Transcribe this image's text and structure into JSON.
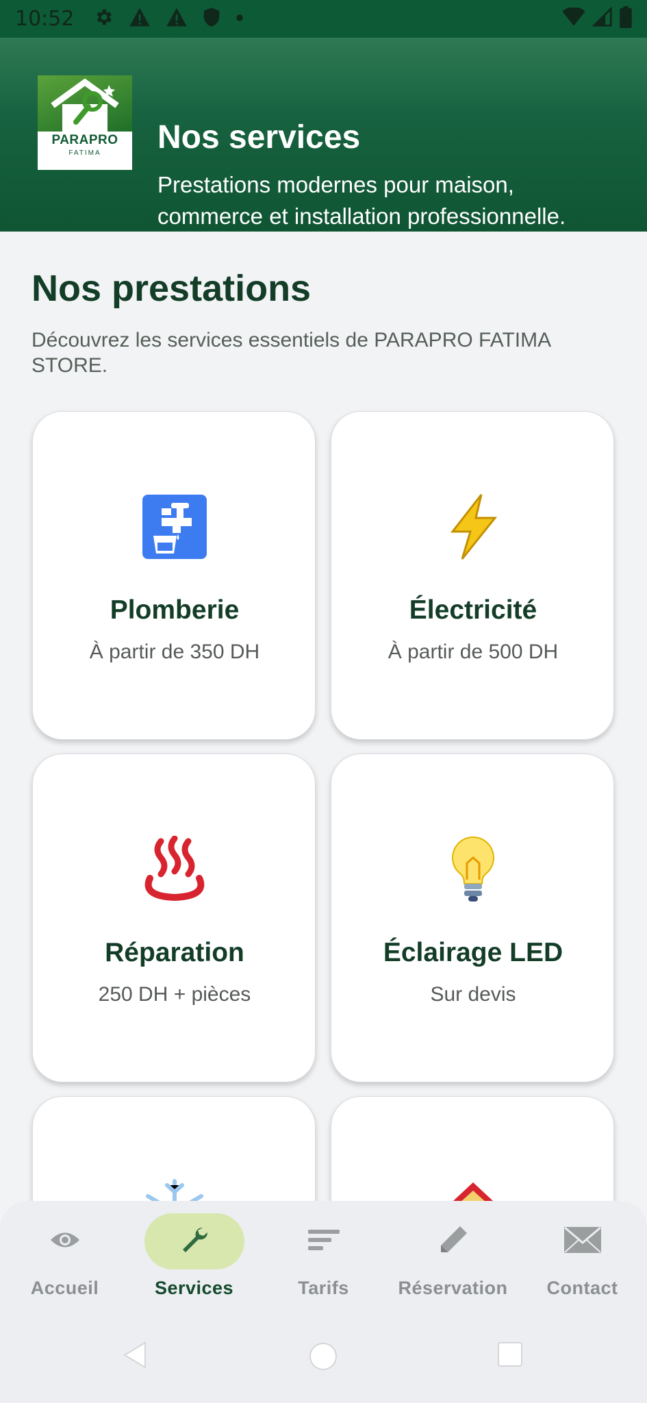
{
  "status_bar": {
    "time": "10:52",
    "left_icons": [
      "gear-icon",
      "warning-icon",
      "warning-icon",
      "shield-icon",
      "dot-icon"
    ],
    "right_icons": [
      "wifi-icon",
      "signal-icon",
      "battery-icon"
    ]
  },
  "header": {
    "logo_text": "PARAPRO",
    "logo_subtext": "FATIMA",
    "title": "Nos services",
    "subtitle": "Prestations modernes pour maison, commerce et installation professionnelle."
  },
  "main": {
    "section_title": "Nos prestations",
    "section_description": "Découvrez les services essentiels de PARAPRO FATIMA STORE.",
    "services": [
      {
        "icon": "faucet-icon",
        "title": "Plomberie",
        "price": "À partir de 350 DH"
      },
      {
        "icon": "lightning-icon",
        "title": "Électricité",
        "price": "À partir de 500 DH"
      },
      {
        "icon": "heat-icon",
        "title": "Réparation",
        "price": "250 DH + pièces"
      },
      {
        "icon": "lightbulb-icon",
        "title": "Éclairage LED",
        "price": "Sur devis"
      },
      {
        "icon": "snowflake-icon",
        "title": "",
        "price": ""
      },
      {
        "icon": "house-icon",
        "title": "",
        "price": ""
      }
    ]
  },
  "bottom_nav": {
    "active": "Services",
    "items": [
      {
        "label": "Accueil",
        "icon": "eye-icon"
      },
      {
        "label": "Services",
        "icon": "wrench-icon"
      },
      {
        "label": "Tarifs",
        "icon": "lines-icon"
      },
      {
        "label": "Réservation",
        "icon": "pencil-icon"
      },
      {
        "label": "Contact",
        "icon": "envelope-icon"
      }
    ]
  },
  "colors": {
    "brand_green": "#0d5a36",
    "title_green": "#133d27",
    "active_pill": "#d8e7ae"
  }
}
